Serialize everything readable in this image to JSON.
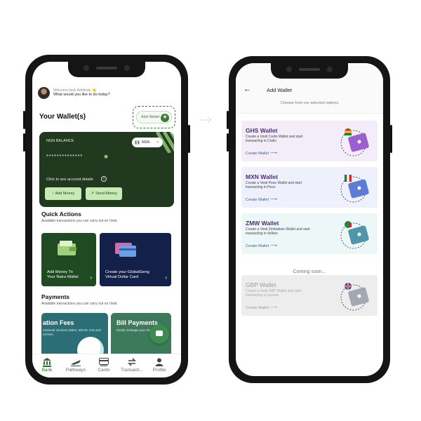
{
  "screen1": {
    "welcome_line": "Welcome back Adefiodu 👋",
    "welcome_question": "What would you like to do today?",
    "wallets_title": "Your Wallet(s)",
    "add_wallet_label": "Add Wallet",
    "balance": {
      "label": "NGN BALANCE",
      "masked_value": "**************",
      "currency": "NGN",
      "see_details": "Click to see account details",
      "add_money": "Add Money",
      "send_money": "Send Money"
    },
    "quick_actions": {
      "title": "Quick Actions",
      "subtitle": "Available transactions you can carry out on Vesti.",
      "cards": [
        {
          "text_line1": "Add Money To",
          "text_line2": "Your Naira Wallet"
        },
        {
          "text_line1": "Create your GlobalGeng",
          "text_line2": "Virtual Dollar Card"
        }
      ]
    },
    "payments": {
      "title": "Payments",
      "subtitle": "Available transactions you can carry out on Vesti.",
      "cards": [
        {
          "title": "ation Fees",
          "subtitle": "rnational services (WES, SEVIS, IHS and",
          "subtitle2": "ed fees."
        },
        {
          "title": "Bill Payments",
          "subtitle": "Easily recharge your device"
        }
      ]
    },
    "tabs": [
      "Bank",
      "Pathways",
      "Cards",
      "Transacti...",
      "Profile"
    ]
  },
  "screen2": {
    "title": "Add Wallet",
    "subtitle": "Choose from our selected options",
    "wallets": [
      {
        "name": "GHS Wallet",
        "desc_line1": "Create a Vesti Cedis Wallet and start",
        "desc_line2": "transacting in Cedis",
        "cta": "Create Wallet",
        "bg": "#f3edfa",
        "wallet_color": "#9b5fcf"
      },
      {
        "name": "MXN Wallet",
        "desc_line1": "Create a Vesti Peso Wallet and start",
        "desc_line2": "transacting in Peso",
        "cta": "Create Wallet",
        "bg": "#eef1fb",
        "wallet_color": "#5c7cd6"
      },
      {
        "name": "ZMW Wallet",
        "desc_line1": "Create a Vesti Zimbabwe Wallet and start",
        "desc_line2": "transacting in dollars",
        "cta": "Create Wallet",
        "bg": "#eef7f7",
        "wallet_color": "#4e96a8"
      }
    ],
    "coming_soon": "Coming soon...",
    "upcoming": {
      "name": "GBP Wallet",
      "desc_line1": "Create a Vesti GBP Wallet and start",
      "desc_line2": "transacting in pounds",
      "cta": "Create Wallet",
      "bg": "#ededed",
      "wallet_color": "#a3a9b3"
    }
  },
  "colors": {
    "brand_green": "#3c7d34",
    "balance_card": "#21391e",
    "qa_card_green": "#1f4a22",
    "qa_card_navy": "#13204a",
    "pay_card_teal": "#2b6e76",
    "pay_card_green": "#3d7a5c"
  }
}
